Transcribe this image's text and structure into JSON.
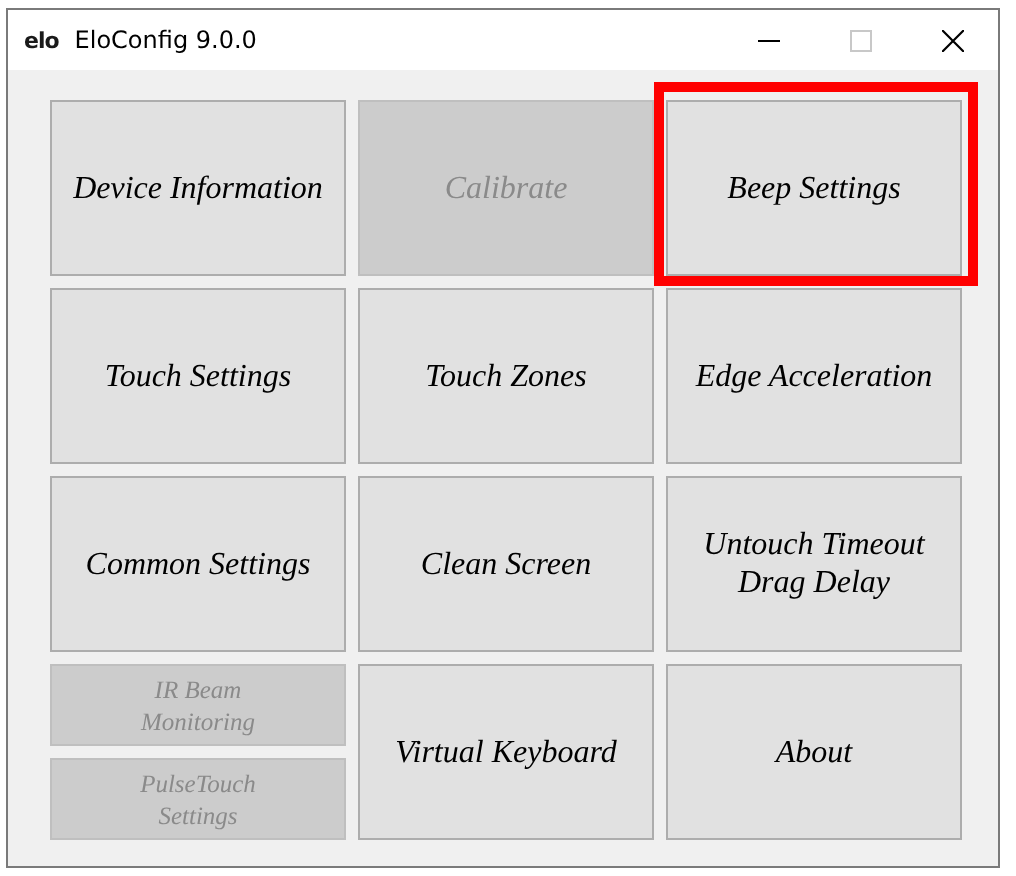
{
  "window": {
    "title": "EloConfig 9.0.0",
    "logo": "elo"
  },
  "buttons": [
    {
      "kind": "button",
      "label": "Device Information",
      "disabled": false,
      "highlighted": false
    },
    {
      "kind": "button",
      "label": "Calibrate",
      "disabled": true,
      "highlighted": false
    },
    {
      "kind": "button",
      "label": "Beep Settings",
      "disabled": false,
      "highlighted": true
    },
    {
      "kind": "button",
      "label": "Touch Settings",
      "disabled": false,
      "highlighted": false
    },
    {
      "kind": "button",
      "label": "Touch Zones",
      "disabled": false,
      "highlighted": false
    },
    {
      "kind": "button",
      "label": "Edge Acceleration",
      "disabled": false,
      "highlighted": false
    },
    {
      "kind": "button",
      "label": "Common Settings",
      "disabled": false,
      "highlighted": false
    },
    {
      "kind": "button",
      "label": "Clean Screen",
      "disabled": false,
      "highlighted": false
    },
    {
      "kind": "button",
      "label": "Untouch Timeout\nDrag Delay",
      "disabled": false,
      "highlighted": false
    },
    {
      "kind": "stack",
      "buttons": [
        {
          "label": "IR Beam\nMonitoring",
          "disabled": true
        },
        {
          "label": "PulseTouch\nSettings",
          "disabled": true
        }
      ]
    },
    {
      "kind": "button",
      "label": "Virtual Keyboard",
      "disabled": false,
      "highlighted": false
    },
    {
      "kind": "button",
      "label": "About",
      "disabled": false,
      "highlighted": false
    }
  ]
}
